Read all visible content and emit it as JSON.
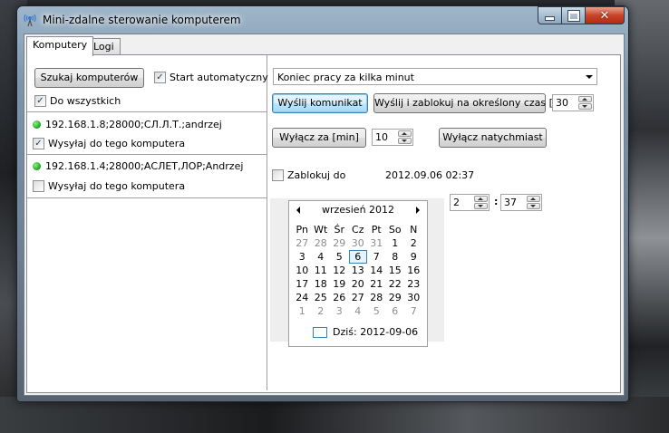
{
  "window": {
    "title": "Mini-zdalne sterowanie komputerem",
    "accent": "#3c7fb1"
  },
  "tabs": [
    {
      "label": "Komputery",
      "active": true
    },
    {
      "label": "Logi",
      "active": false
    }
  ],
  "left": {
    "search_button": "Szukaj komputerów",
    "auto_start": {
      "label": "Start automatyczny",
      "checked": true
    },
    "all": {
      "label": "Do wszystkich",
      "checked": true
    },
    "computers": [
      {
        "address": "192.168.1.8;28000;СЛ.Л.Т.;andrzej",
        "status_color": "#12a412",
        "send_label": "Wysyłaj do tego komputera",
        "send_checked": true
      },
      {
        "address": "192.168.1.4;28000;АСЛЕТ,ЛОР;Andrzej",
        "status_color": "#12a412",
        "send_label": "Wysyłaj do tego komputera",
        "send_checked": false
      }
    ]
  },
  "right": {
    "action_select": "Koniec pracy za kilka minut",
    "send_message_button": "Wyślij komunikat",
    "send_lock_button": "Wyślij i zablokuj na określony czas [s]",
    "lock_seconds": "30",
    "shutdown_after_button": "Wyłącz za [min]",
    "shutdown_minutes": "10",
    "shutdown_now_button": "Wyłącz natychmiast",
    "lock_until": {
      "label": "Zablokuj do",
      "checked": false,
      "datetime": "2012.09.06 02:37"
    },
    "hour": "2",
    "time_separator": ":",
    "minute": "37"
  },
  "calendar": {
    "month_title": "wrzesień 2012",
    "weekdays": [
      "Pn",
      "Wt",
      "Śr",
      "Cz",
      "Pt",
      "So",
      "N"
    ],
    "weeks": [
      [
        {
          "d": "27",
          "m": true
        },
        {
          "d": "28",
          "m": true
        },
        {
          "d": "29",
          "m": true
        },
        {
          "d": "30",
          "m": true
        },
        {
          "d": "31",
          "m": true
        },
        {
          "d": "1"
        },
        {
          "d": "2"
        }
      ],
      [
        {
          "d": "3"
        },
        {
          "d": "4"
        },
        {
          "d": "5"
        },
        {
          "d": "6",
          "sel": true
        },
        {
          "d": "7"
        },
        {
          "d": "8"
        },
        {
          "d": "9"
        }
      ],
      [
        {
          "d": "10"
        },
        {
          "d": "11"
        },
        {
          "d": "12"
        },
        {
          "d": "13"
        },
        {
          "d": "14"
        },
        {
          "d": "15"
        },
        {
          "d": "16"
        }
      ],
      [
        {
          "d": "17"
        },
        {
          "d": "18"
        },
        {
          "d": "19"
        },
        {
          "d": "20"
        },
        {
          "d": "21"
        },
        {
          "d": "22"
        },
        {
          "d": "23"
        }
      ],
      [
        {
          "d": "24"
        },
        {
          "d": "25"
        },
        {
          "d": "26"
        },
        {
          "d": "27"
        },
        {
          "d": "28"
        },
        {
          "d": "29"
        },
        {
          "d": "30"
        }
      ],
      [
        {
          "d": "1",
          "m": true
        },
        {
          "d": "2",
          "m": true
        },
        {
          "d": "3",
          "m": true
        },
        {
          "d": "4",
          "m": true
        },
        {
          "d": "5",
          "m": true
        },
        {
          "d": "6",
          "m": true
        },
        {
          "d": "7",
          "m": true
        }
      ]
    ],
    "today_label": "Dziś: 2012-09-06"
  }
}
